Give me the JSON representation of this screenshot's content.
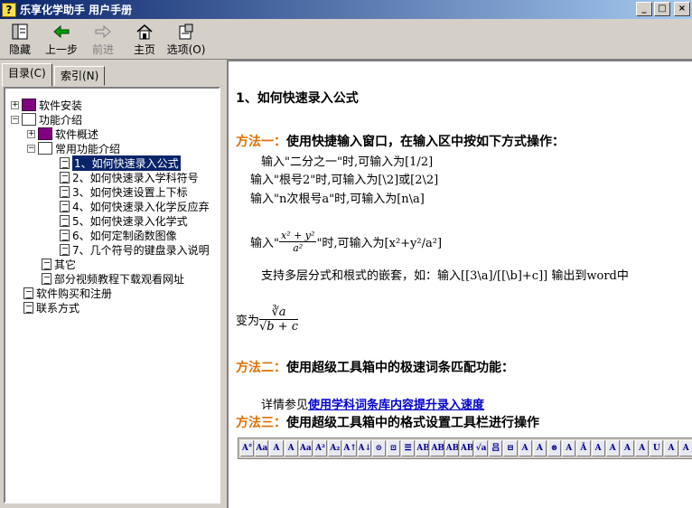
{
  "window": {
    "title": "乐享化学助手 用户手册",
    "app_icon": "?"
  },
  "toolbar": {
    "hide": "隐藏",
    "back": "上一步",
    "forward": "前进",
    "home": "主页",
    "options": "选项(O)"
  },
  "tabs": {
    "contents": "目录(C)",
    "index": "索引(N)"
  },
  "tree": [
    {
      "label": "软件安装",
      "type": "book",
      "expander": "+"
    },
    {
      "label": "功能介绍",
      "type": "book-open",
      "expander": "−"
    },
    {
      "label": "软件概述",
      "type": "book",
      "expander": "+"
    },
    {
      "label": "常用功能介绍",
      "type": "book-open",
      "expander": "−"
    },
    {
      "label": "1、如何快速录入公式",
      "type": "page",
      "selected": true
    },
    {
      "label": "2、如何快速录入学科符号",
      "type": "page"
    },
    {
      "label": "3、如何快速设置上下标",
      "type": "page"
    },
    {
      "label": "4、如何快速录入化学反应弃",
      "type": "page"
    },
    {
      "label": "5、如何快速录入化学式",
      "type": "page"
    },
    {
      "label": "6、如何定制函数图像",
      "type": "page"
    },
    {
      "label": "7、几个符号的键盘录入说明",
      "type": "page"
    },
    {
      "label": "其它",
      "type": "page"
    },
    {
      "label": "部分视频教程下载观看网址",
      "type": "page"
    },
    {
      "label": "软件购买和注册",
      "type": "page"
    },
    {
      "label": "联系方式",
      "type": "page"
    }
  ],
  "content": {
    "heading": "1、如何快速录入公式",
    "method1_label": "方法一：",
    "method1_text": "使用快捷输入窗口，在输入区中按如下方式操作：",
    "line1": "输入\"二分之一\"时,可输入为[1/2]",
    "line2": "输入\"根号2\"时,可输入为[\\2]或[2\\2]",
    "line3": "输入\"n次根号a\"时,可输入为[n\\a]",
    "line4_pre": "输入\"",
    "line4_num": "x² + y²",
    "line4_den": "a²",
    "line4_post": "\"时,可输入为[x²+y²/a²]",
    "line5": "支持多层分式和根式的嵌套，如：输入[[3\\a]/[[\\b]+c]]   输出到word中",
    "line6_pre": "变为",
    "line6_num": "∛a",
    "line6_den": "√b + c",
    "method2_label": "方法二：",
    "method2_text": "使用超级工具箱中的极速词条匹配功能：",
    "see_pre": "详情参见",
    "see_link": "使用学科词条库内容提升录入速度",
    "method3_label": "方法三：",
    "method3_text": "使用超级工具箱中的格式设置工具栏进行操作"
  },
  "format_buttons": [
    "A°",
    "Aa",
    "A",
    "A",
    "Aa",
    "A²",
    "A₂",
    "A↑",
    "A↓",
    "⊙",
    "⊡",
    "☰",
    "AB",
    "AB",
    "AB",
    "AB",
    "√a",
    "吕",
    "⊟",
    "A",
    "A",
    "⊗",
    "A",
    "Ā",
    "A",
    "A",
    "A",
    "A",
    "U",
    "A",
    "A"
  ]
}
